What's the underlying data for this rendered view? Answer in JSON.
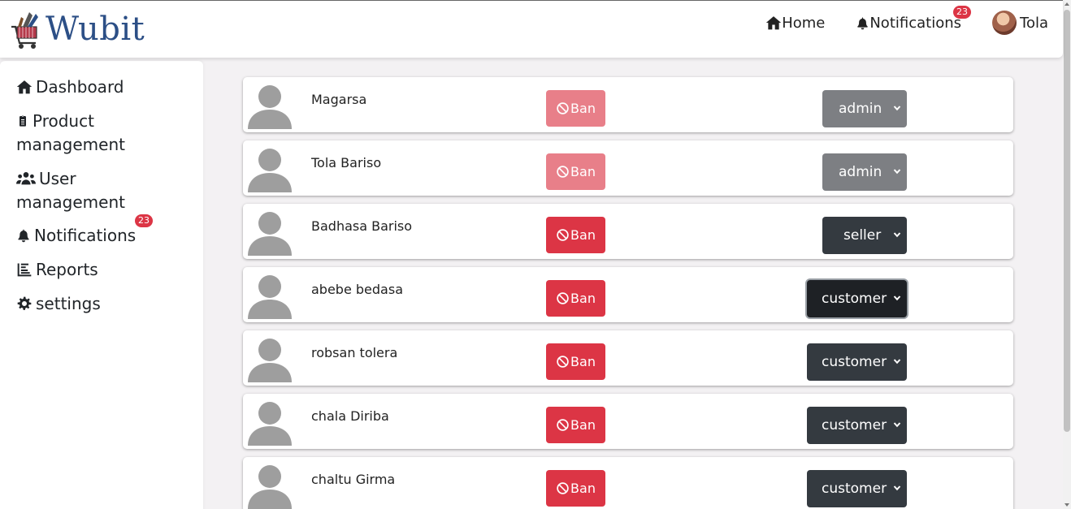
{
  "brand": {
    "name": "Wubit"
  },
  "topnav": {
    "home_label": "Home",
    "notifications_label": "Notifications",
    "notifications_count": "23",
    "user_name": "Tola"
  },
  "sidebar": {
    "items": [
      {
        "label": "Dashboard",
        "icon": "home-icon"
      },
      {
        "label": "Product management",
        "icon": "clipboard-icon"
      },
      {
        "label": "User management",
        "icon": "users-icon"
      },
      {
        "label": "Notifications",
        "icon": "bell-icon",
        "badge": "23"
      },
      {
        "label": "Reports",
        "icon": "chart-icon"
      },
      {
        "label": "settings",
        "icon": "gear-icon"
      }
    ]
  },
  "users": [
    {
      "name": "Magarsa",
      "ban_label": "Ban",
      "ban_disabled": true,
      "role": "admin"
    },
    {
      "name": "Tola Bariso",
      "ban_label": "Ban",
      "ban_disabled": true,
      "role": "admin"
    },
    {
      "name": "Badhasa Bariso",
      "ban_label": "Ban",
      "ban_disabled": false,
      "role": "seller"
    },
    {
      "name": "abebe bedasa",
      "ban_label": "Ban",
      "ban_disabled": false,
      "role": "customer"
    },
    {
      "name": "robsan tolera",
      "ban_label": "Ban",
      "ban_disabled": false,
      "role": "customer"
    },
    {
      "name": "chala Diriba",
      "ban_label": "Ban",
      "ban_disabled": false,
      "role": "customer"
    },
    {
      "name": "chaltu Girma",
      "ban_label": "Ban",
      "ban_disabled": false,
      "role": "customer"
    }
  ],
  "colors": {
    "danger": "#dc3545",
    "danger_disabled": "#e87f89",
    "admin_select": "#7d7f83",
    "dark_select": "#343a40",
    "brand": "#2c4f86"
  }
}
